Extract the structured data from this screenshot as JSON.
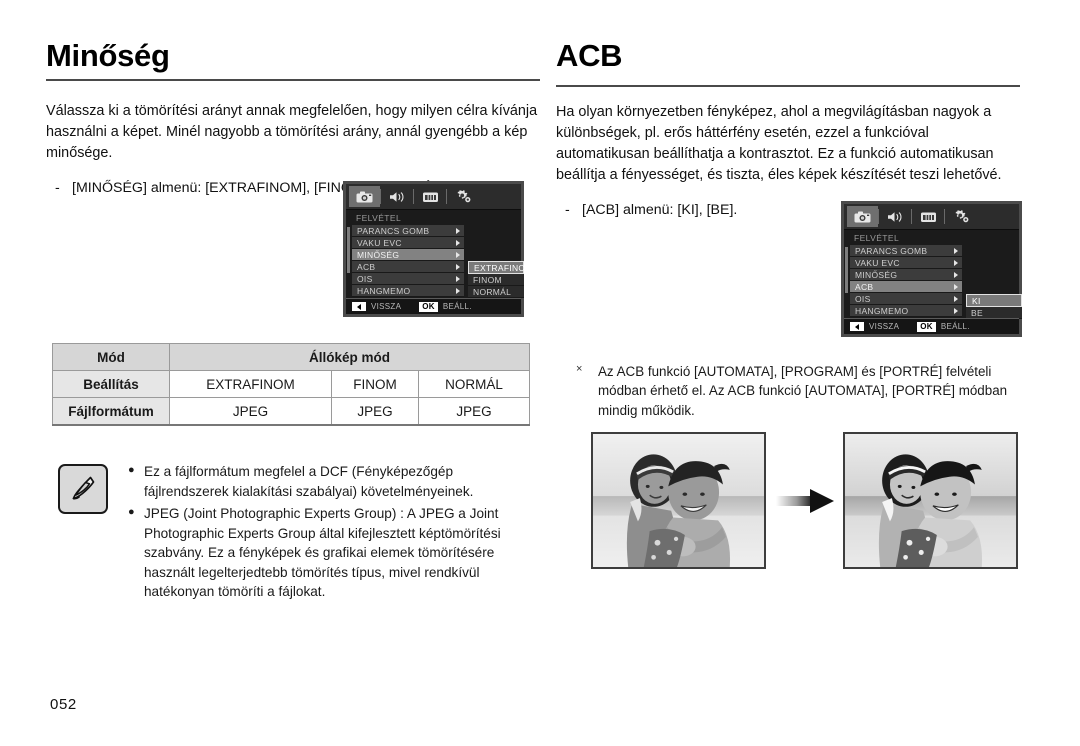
{
  "page": {
    "number": "052"
  },
  "left": {
    "heading": "Minőség",
    "intro": "Válassza ki a tömörítési arányt annak megfelelően, hogy milyen célra kívánja használni a képet. Minél nagyobb a tömörítési arány, annál gyengébb a kép minősége.",
    "dash_mark": "-",
    "submenu_line": "[MINŐSÉG] almenü: [EXTRAFINOM], [FINOM], [NORMÁL].",
    "lcd": {
      "title": "FELVÉTEL",
      "tabs": [
        "camera-icon",
        "sound-icon",
        "display-icon",
        "settings-icon"
      ],
      "active_tab_index": 0,
      "rows": [
        {
          "label": "PARANCS GOMB",
          "selected": false
        },
        {
          "label": "VAKU EVC",
          "selected": false
        },
        {
          "label": "MINŐSÉG",
          "selected": true
        },
        {
          "label": "ACB",
          "selected": false
        },
        {
          "label": "OIS",
          "selected": false
        },
        {
          "label": "HANGMEMO",
          "selected": false
        }
      ],
      "submenu": [
        {
          "label": "EXTRAFINOM",
          "selected": true
        },
        {
          "label": "FINOM",
          "selected": false
        },
        {
          "label": "NORMÁL",
          "selected": false
        }
      ],
      "footer_back": "VISSZA",
      "footer_ok": "OK",
      "footer_set": "BEÁLL."
    },
    "table": {
      "header": {
        "col1": "Mód",
        "col2": "Állókép mód"
      },
      "rows": [
        {
          "label": "Beállítás",
          "values": [
            "EXTRAFINOM",
            "FINOM",
            "NORMÁL"
          ]
        },
        {
          "label": "Fájlformátum",
          "values": [
            "JPEG",
            "JPEG",
            "JPEG"
          ]
        }
      ]
    },
    "note": {
      "icon": "note-pen-icon",
      "bullet": "●",
      "items": [
        "Ez a fájlformátum megfelel a DCF (Fényképezőgép fájlrendszerek kialakítási szabályai) követelményeinek.",
        "JPEG (Joint Photographic Experts Group) : A JPEG a Joint Photographic Experts Group által kifejlesztett képtömörítési szabvány. Ez a fényképek és grafikai elemek tömörítésére használt legelterjedtebb tömörítés típus, mivel rendkívül hatékonyan tömöríti a fájlokat."
      ]
    }
  },
  "right": {
    "heading": "ACB",
    "intro": "Ha olyan környezetben fényképez, ahol a megvilágításban nagyok a különbségek, pl. erős háttérfény esetén, ezzel a funkcióval automatikusan beállíthatja a kontrasztot. Ez a funkció automatikusan beállítja a fényességet, és tiszta, éles képek készítését teszi lehetővé.",
    "dash_mark": "-",
    "submenu_line": "[ACB] almenü: [KI], [BE].",
    "lcd": {
      "title": "FELVÉTEL",
      "tabs": [
        "camera-icon",
        "sound-icon",
        "display-icon",
        "settings-icon"
      ],
      "active_tab_index": 0,
      "rows": [
        {
          "label": "PARANCS GOMB",
          "selected": false
        },
        {
          "label": "VAKU EVC",
          "selected": false
        },
        {
          "label": "MINŐSÉG",
          "selected": false
        },
        {
          "label": "ACB",
          "selected": true
        },
        {
          "label": "OIS",
          "selected": false
        },
        {
          "label": "HANGMEMO",
          "selected": false
        }
      ],
      "submenu": [
        {
          "label": "KI",
          "selected": true
        },
        {
          "label": "BE",
          "selected": false
        }
      ],
      "footer_back": "VISSZA",
      "footer_ok": "OK",
      "footer_set": "BEÁLL."
    },
    "x_note": {
      "mark": "×",
      "text": "Az ACB funkció [AUTOMATA], [PROGRAM] és [PORTRÉ] felvételi módban érhető el. Az ACB funkció [AUTOMATA], [PORTRÉ] módban mindig működik."
    },
    "samples": {
      "before_alt": "beach-photo-before",
      "after_alt": "beach-photo-after",
      "arrow": "right-arrow-graphic"
    }
  }
}
